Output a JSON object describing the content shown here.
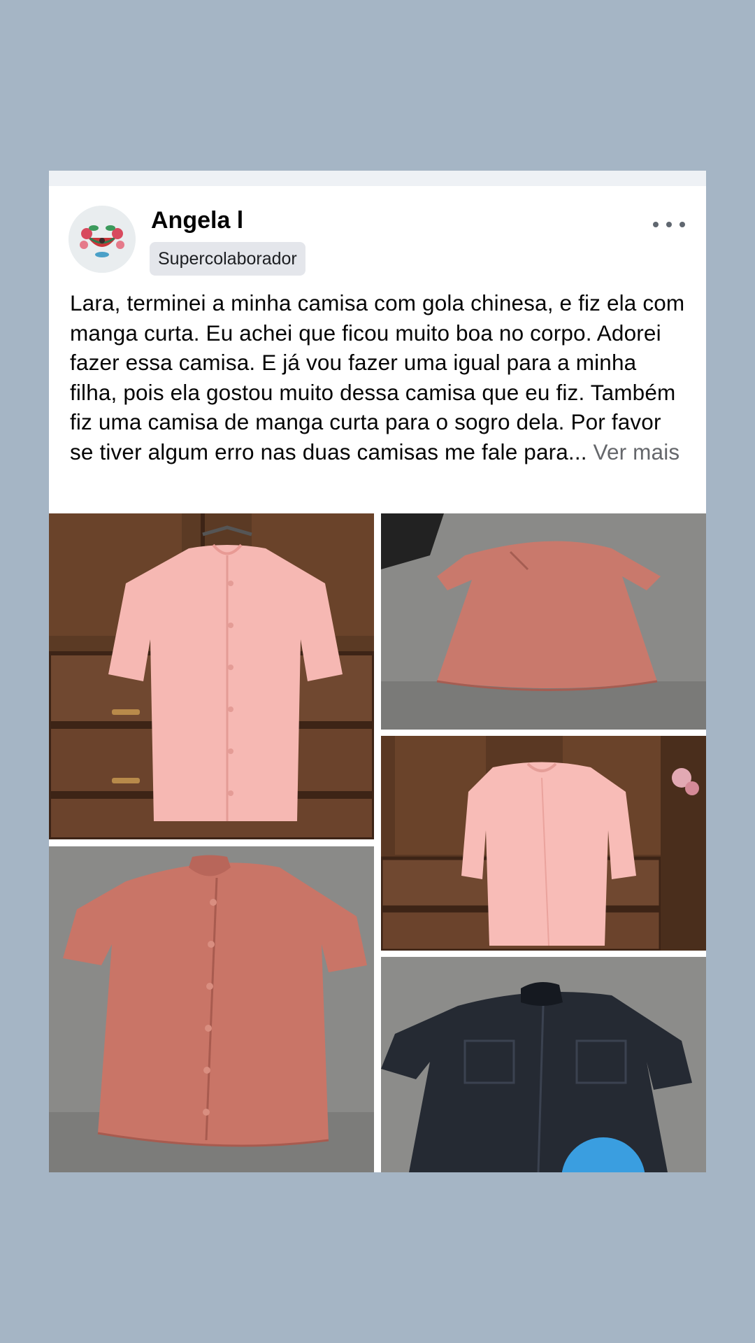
{
  "post": {
    "author": "Angela l",
    "badge": "Supercolaborador",
    "text": "Lara, terminei a minha camisa com gola chinesa, e fiz ela com manga curta. Eu achei que ficou muito boa no corpo. Adorei fazer essa camisa. E já vou fazer uma igual para  a minha filha, pois ela gostou  muito dessa camisa que eu fiz. Também fiz uma camisa de manga curta para o sogro dela.  Por favor se tiver algum erro nas duas camisas me fale para...",
    "see_more": "Ver mais",
    "more_icon": "more-options-icon",
    "avatar_icon": "floral-avatar"
  },
  "photos": [
    {
      "subject": "pink short-sleeve shirt on hanger in front of wooden wardrobe"
    },
    {
      "subject": "salmon shirt laid flat, back view"
    },
    {
      "subject": "pink shirt on hanger, back view"
    },
    {
      "subject": "salmon shirt laid flat, front view"
    },
    {
      "subject": "dark navy short-sleeve shirt laid flat"
    }
  ],
  "colors": {
    "background": "#a5b5c5",
    "card": "#ffffff",
    "badge_bg": "#e4e6eb",
    "see_more": "#65676b"
  }
}
